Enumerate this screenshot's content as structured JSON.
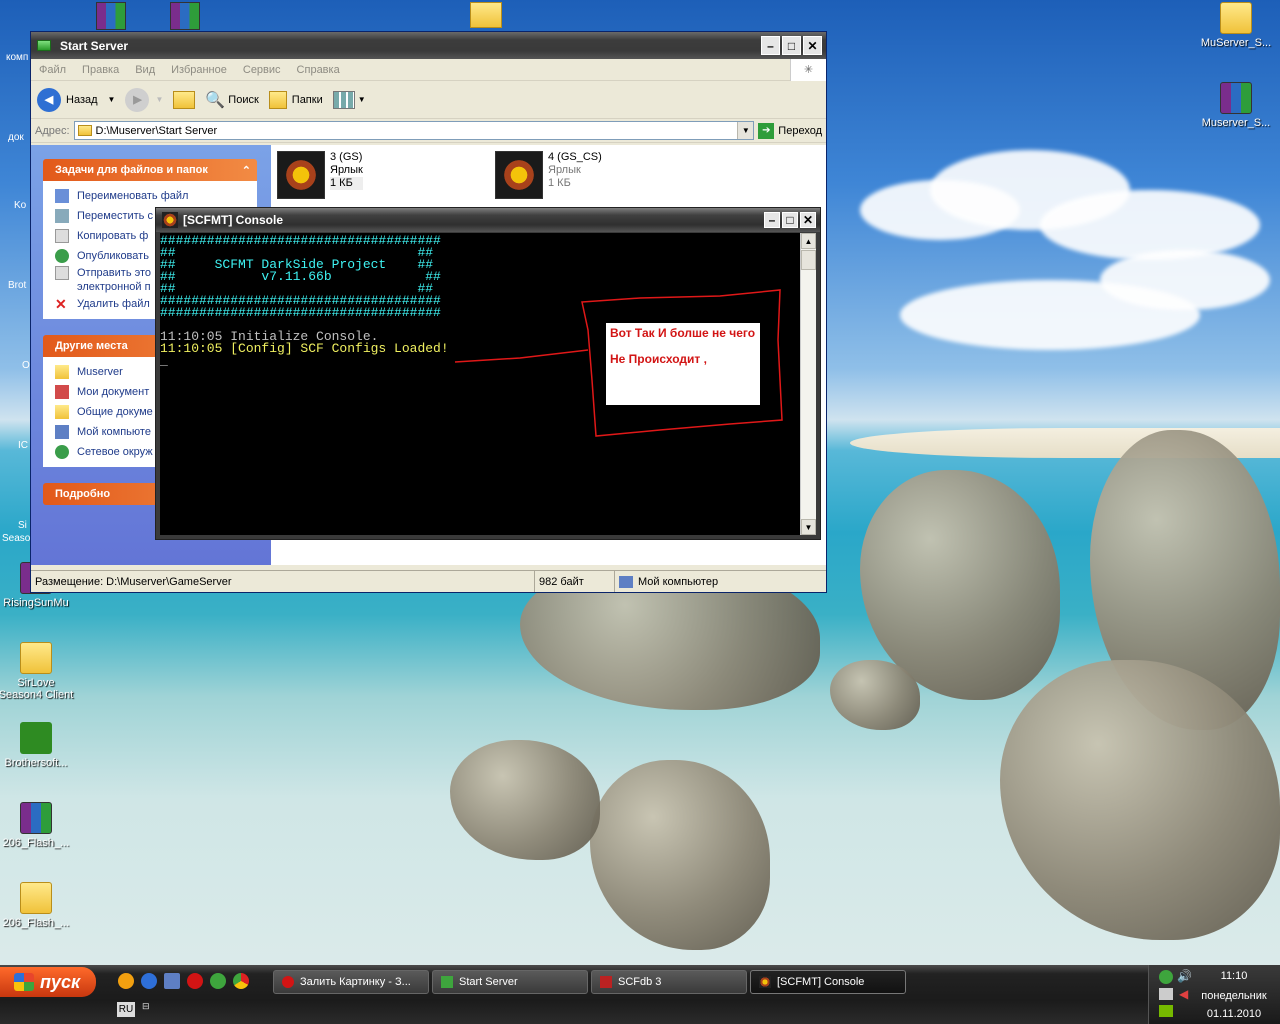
{
  "desktop": {
    "icons": [
      {
        "label": "MuServer_S...",
        "type": "folder"
      },
      {
        "label": "Muserver_S...",
        "type": "rar"
      },
      {
        "label": "RisingSunMu",
        "type": "rar"
      },
      {
        "label": "SirLove Season4 Client",
        "type": "folder"
      },
      {
        "label": "Brothersoft...",
        "type": "star"
      },
      {
        "label": "206_Flash_...",
        "type": "rar"
      },
      {
        "label": "206_Flash_...",
        "type": "folder"
      }
    ],
    "left_partial_labels": [
      "комп",
      "док",
      "Ko",
      "Brot",
      "O",
      "IC",
      "Si",
      "Seaso"
    ]
  },
  "explorer": {
    "title": "Start Server",
    "menu": [
      "Файл",
      "Правка",
      "Вид",
      "Избранное",
      "Сервис",
      "Справка"
    ],
    "toolbar": {
      "back": "Назад",
      "search": "Поиск",
      "folders": "Папки"
    },
    "address_label": "Адрес:",
    "address": "D:\\Muserver\\Start Server",
    "go": "Переход",
    "tasks_header": "Задачи для файлов и папок",
    "tasks": [
      "Переименовать файл",
      "Переместить с",
      "Копировать ф",
      "Опубликовать",
      "Отправить это",
      "электронной п",
      "Удалить файл"
    ],
    "places_header": "Другие места",
    "places": [
      "Muserver",
      "Мои документ",
      "Общие докуме",
      "Мой компьюте",
      "Сетевое окруж"
    ],
    "details_header": "Подробно",
    "files": [
      {
        "name": "3 (GS)",
        "type": "Ярлык",
        "size": "1 КБ"
      },
      {
        "name": "4 (GS_CS)",
        "type": "Ярлык",
        "size": "1 КБ"
      }
    ],
    "status": {
      "location": "Размещение: D:\\Muserver\\GameServer",
      "size": "982 байт",
      "computer": "Мой компьютер"
    }
  },
  "console": {
    "title": "[SCFMT] Console",
    "lines": [
      {
        "text": "####################################",
        "color": "cyan"
      },
      {
        "text": "##                               ##",
        "color": "cyan"
      },
      {
        "text": "##     SCFMT DarkSide Project    ##",
        "color": "cyan"
      },
      {
        "text": "##           v7.11.66b            ##",
        "color": "cyan"
      },
      {
        "text": "##                               ##",
        "color": "cyan"
      },
      {
        "text": "####################################",
        "color": "cyan"
      },
      {
        "text": "####################################",
        "color": "cyan"
      },
      {
        "text": "",
        "color": "gray"
      },
      {
        "text": "11:10:05 Initialize Console.",
        "color": "gray"
      },
      {
        "text": "11:10:05 [Config] SCF Configs Loaded!",
        "color": "yellow"
      },
      {
        "text": "_",
        "color": "gray"
      }
    ]
  },
  "annotation": {
    "line1": "Вот Так И болше не чего",
    "line2": "Не Происходит ,",
    "color": "#d21414"
  },
  "taskbar": {
    "start": "пуск",
    "tasks": [
      {
        "label": "Залить Картинку - З...",
        "icon": "opera-icon"
      },
      {
        "label": "Start Server",
        "icon": "folder-icon"
      },
      {
        "label": "SCFdb 3",
        "icon": "app-icon"
      },
      {
        "label": "[SCFMT] Console",
        "icon": "mu-icon",
        "active": true
      }
    ],
    "lang": "RU",
    "time": "11:10",
    "day": "понедельник",
    "date": "01.11.2010"
  }
}
